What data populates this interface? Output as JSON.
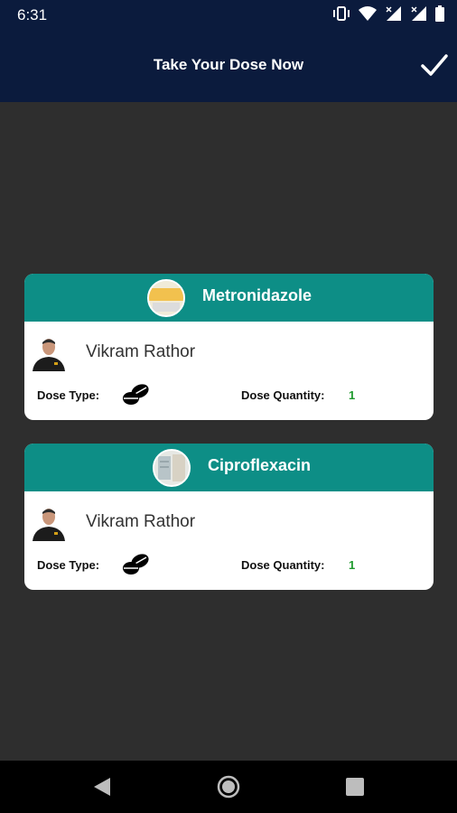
{
  "status_bar": {
    "time": "6:31",
    "icons": [
      "vibrate-icon",
      "wifi-icon",
      "signal-icon",
      "signal-icon",
      "battery-icon"
    ]
  },
  "app_bar": {
    "title": "Take Your Dose Now",
    "confirm_icon": "check-icon"
  },
  "cards": [
    {
      "medicine": "Metronidazole",
      "patient": "Vikram Rathor",
      "dose_type_label": "Dose Type:",
      "dose_type_icon": "pills-icon",
      "dose_quantity_label": "Dose Quantity:",
      "dose_quantity": "1"
    },
    {
      "medicine": "Ciproflexacin",
      "patient": "Vikram Rathor",
      "dose_type_label": "Dose Type:",
      "dose_type_icon": "pills-icon",
      "dose_quantity_label": "Dose Quantity:",
      "dose_quantity": "1"
    }
  ],
  "colors": {
    "app_bar": "#0b1b3d",
    "background": "#2e2e2e",
    "card_header": "#0d8e86",
    "quantity": "#1f9a2e"
  },
  "nav_bar": {
    "buttons": [
      "back-icon",
      "home-icon",
      "recents-icon"
    ]
  }
}
